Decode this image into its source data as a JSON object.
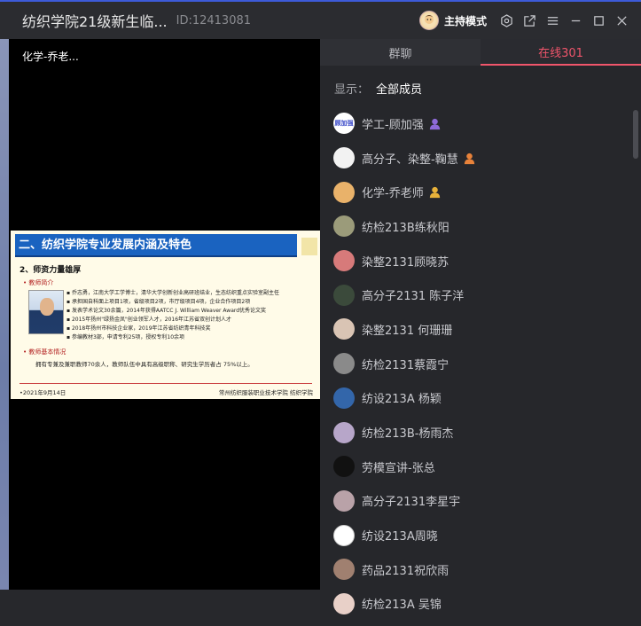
{
  "window": {
    "title": "纺织学院21级新生临...",
    "room_id": "ID:12413081",
    "host_mode": "主持模式"
  },
  "video": {
    "speaker": "化学-乔老...",
    "slide": {
      "banner": "二、纺织学院专业发展内涵及特色",
      "subtitle": "2、师资力量雄厚",
      "section1": "•  教师简介",
      "bullets": [
        "▪ 乔志勇，江南大学工学博士，清华大学创新创业高研班结业，生态纺织重点实验室副主任",
        "▪ 承担国自科面上项目1项，省级项目2项，市厅级项目4项，企业合作项目2项",
        "▪ 发表学术论文30余篇，2014年获得AATCC J. William Weaver Award优秀论文奖",
        "▪ 2015年扬州\"绿扬金凤\"创业领军人才，2016年江苏省双创计划人才",
        "▪ 2018年扬州市科技企业家，2019年江苏省纺织青年科技奖",
        "▪ 参编教材3部，申请专利25项，授权专利10余项"
      ],
      "section2": "•  教师基本情况",
      "staff_text": "拥有专兼及兼职教师70余人，教师队伍中具有高级职称、研究生学历者占 75%以上。",
      "footer_date": "•2021年9月14日",
      "footer_school": "常州纺织服装职业技术学院 纺织学院"
    }
  },
  "panel": {
    "tabs": [
      "群聊",
      "在线301"
    ],
    "active_tab": 1,
    "filter_label": "显示：",
    "filter_value": "全部成员",
    "members": [
      {
        "name": "学工-顾加强",
        "avatar_text": "顾加强",
        "avatar_color": "#3a49c8",
        "role": "purple"
      },
      {
        "name": "高分子、染整-鞠慧",
        "avatar_text": "",
        "avatar_color": "#f2f2f2",
        "role": "orange"
      },
      {
        "name": "化学-乔老师",
        "avatar_text": "",
        "avatar_color": "#e9b26a",
        "role": "yellow"
      },
      {
        "name": "纺检213B练秋阳",
        "avatar_text": "",
        "avatar_color": "#9b9b7a",
        "role": ""
      },
      {
        "name": "染整2131顾晓苏",
        "avatar_text": "",
        "avatar_color": "#d77a7a",
        "role": ""
      },
      {
        "name": "高分子2131 陈子洋",
        "avatar_text": "",
        "avatar_color": "#3b4a3b",
        "role": ""
      },
      {
        "name": "染整2131 何珊珊",
        "avatar_text": "",
        "avatar_color": "#d9c4b4",
        "role": ""
      },
      {
        "name": "纺检2131蔡霞宁",
        "avatar_text": "",
        "avatar_color": "#8a8a8a",
        "role": ""
      },
      {
        "name": "纺设213A 杨颖",
        "avatar_text": "",
        "avatar_color": "#3366aa",
        "role": ""
      },
      {
        "name": "纺检213B-杨雨杰",
        "avatar_text": "",
        "avatar_color": "#b7a6c9",
        "role": ""
      },
      {
        "name": "劳模宣讲-张总",
        "avatar_text": "",
        "avatar_color": "#111111",
        "role": ""
      },
      {
        "name": "高分子2131李星宇",
        "avatar_text": "",
        "avatar_color": "#b9a2a8",
        "role": ""
      },
      {
        "name": "纺设213A周晓",
        "avatar_text": "",
        "avatar_color": "#ffffff",
        "role": ""
      },
      {
        "name": "药品2131祝欣雨",
        "avatar_text": "",
        "avatar_color": "#a08070",
        "role": ""
      },
      {
        "name": "纺检213A 吴锦",
        "avatar_text": "",
        "avatar_color": "#e8d0c8",
        "role": ""
      }
    ]
  },
  "colors": {
    "accent": "#f0556b",
    "titlebar_border": "#3d5bd9",
    "role_purple": "#8e6ad8",
    "role_orange": "#e8823a",
    "role_yellow": "#e8b23a"
  }
}
